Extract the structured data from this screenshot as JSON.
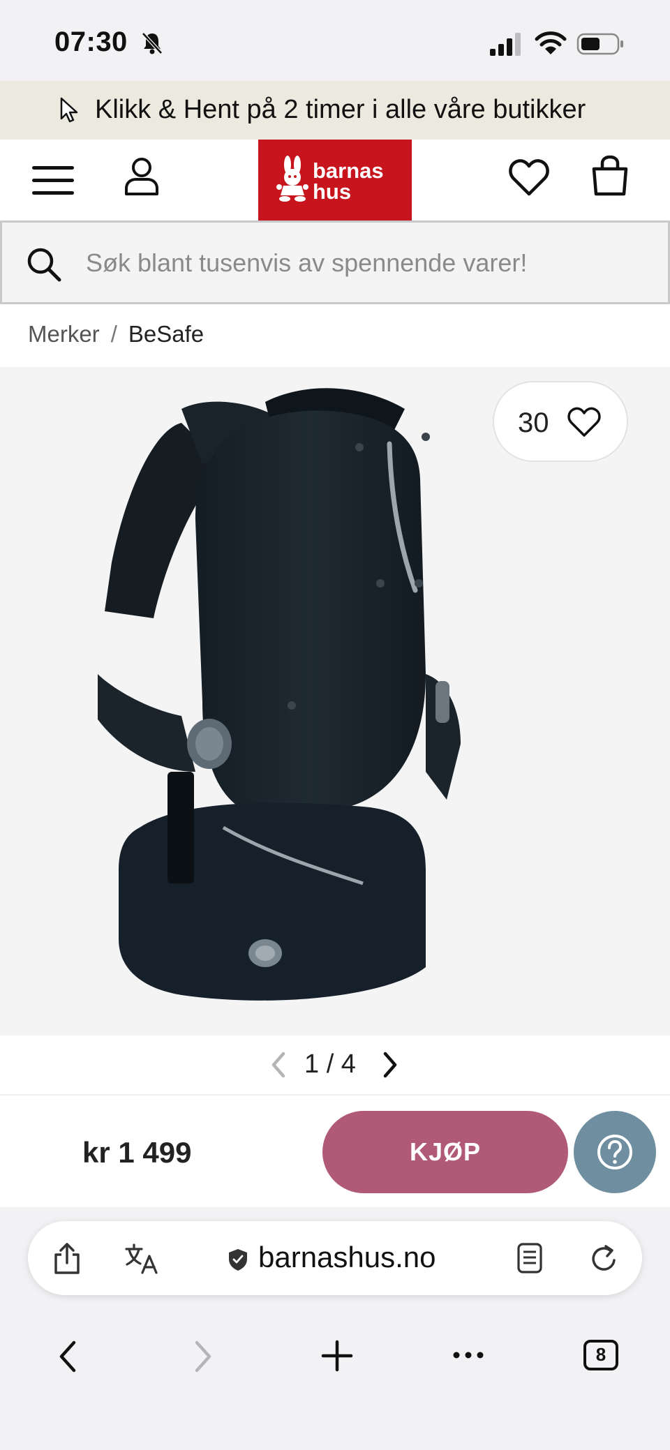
{
  "status_bar": {
    "time": "07:30"
  },
  "promo": {
    "text": "Klikk & Hent på 2 timer i alle våre butikker"
  },
  "header": {
    "logo_line1": "barnas",
    "logo_line2": "hus"
  },
  "search": {
    "placeholder": "Søk blant tusenvis av spennende varer!"
  },
  "breadcrumb": {
    "items": [
      "Merker",
      "BeSafe"
    ],
    "separator": "/"
  },
  "product": {
    "favorite_count": "30",
    "pager": "1 / 4",
    "price": "kr 1 499",
    "buy_label": "KJØP"
  },
  "browser": {
    "url": "barnashus.no",
    "tab_count": "8"
  },
  "colors": {
    "logo_red": "#c8141c",
    "buy_button": "#b05a78",
    "help_button": "#6f8ea0",
    "promo_bg": "#ece9df"
  },
  "icons": [
    "bell-slash-icon",
    "signal-icon",
    "wifi-icon",
    "battery-icon",
    "cursor-icon",
    "menu-icon",
    "user-icon",
    "heart-icon",
    "bag-icon",
    "search-icon",
    "chevron-left-icon",
    "chevron-right-icon",
    "question-icon",
    "share-icon",
    "translate-icon",
    "shield-icon",
    "reader-icon",
    "reload-icon",
    "plus-icon",
    "more-icon"
  ]
}
